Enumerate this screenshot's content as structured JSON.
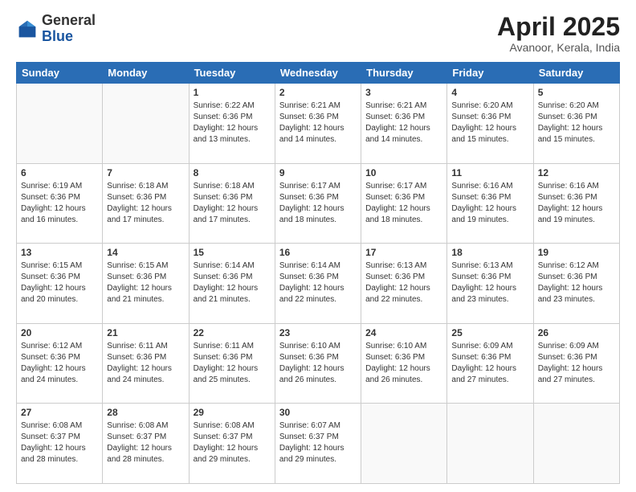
{
  "header": {
    "logo_general": "General",
    "logo_blue": "Blue",
    "title": "April 2025",
    "subtitle": "Avanoor, Kerala, India"
  },
  "calendar": {
    "days_of_week": [
      "Sunday",
      "Monday",
      "Tuesday",
      "Wednesday",
      "Thursday",
      "Friday",
      "Saturday"
    ],
    "weeks": [
      [
        {
          "day": "",
          "sunrise": "",
          "sunset": "",
          "daylight": ""
        },
        {
          "day": "",
          "sunrise": "",
          "sunset": "",
          "daylight": ""
        },
        {
          "day": "1",
          "sunrise": "Sunrise: 6:22 AM",
          "sunset": "Sunset: 6:36 PM",
          "daylight": "Daylight: 12 hours and 13 minutes."
        },
        {
          "day": "2",
          "sunrise": "Sunrise: 6:21 AM",
          "sunset": "Sunset: 6:36 PM",
          "daylight": "Daylight: 12 hours and 14 minutes."
        },
        {
          "day": "3",
          "sunrise": "Sunrise: 6:21 AM",
          "sunset": "Sunset: 6:36 PM",
          "daylight": "Daylight: 12 hours and 14 minutes."
        },
        {
          "day": "4",
          "sunrise": "Sunrise: 6:20 AM",
          "sunset": "Sunset: 6:36 PM",
          "daylight": "Daylight: 12 hours and 15 minutes."
        },
        {
          "day": "5",
          "sunrise": "Sunrise: 6:20 AM",
          "sunset": "Sunset: 6:36 PM",
          "daylight": "Daylight: 12 hours and 15 minutes."
        }
      ],
      [
        {
          "day": "6",
          "sunrise": "Sunrise: 6:19 AM",
          "sunset": "Sunset: 6:36 PM",
          "daylight": "Daylight: 12 hours and 16 minutes."
        },
        {
          "day": "7",
          "sunrise": "Sunrise: 6:18 AM",
          "sunset": "Sunset: 6:36 PM",
          "daylight": "Daylight: 12 hours and 17 minutes."
        },
        {
          "day": "8",
          "sunrise": "Sunrise: 6:18 AM",
          "sunset": "Sunset: 6:36 PM",
          "daylight": "Daylight: 12 hours and 17 minutes."
        },
        {
          "day": "9",
          "sunrise": "Sunrise: 6:17 AM",
          "sunset": "Sunset: 6:36 PM",
          "daylight": "Daylight: 12 hours and 18 minutes."
        },
        {
          "day": "10",
          "sunrise": "Sunrise: 6:17 AM",
          "sunset": "Sunset: 6:36 PM",
          "daylight": "Daylight: 12 hours and 18 minutes."
        },
        {
          "day": "11",
          "sunrise": "Sunrise: 6:16 AM",
          "sunset": "Sunset: 6:36 PM",
          "daylight": "Daylight: 12 hours and 19 minutes."
        },
        {
          "day": "12",
          "sunrise": "Sunrise: 6:16 AM",
          "sunset": "Sunset: 6:36 PM",
          "daylight": "Daylight: 12 hours and 19 minutes."
        }
      ],
      [
        {
          "day": "13",
          "sunrise": "Sunrise: 6:15 AM",
          "sunset": "Sunset: 6:36 PM",
          "daylight": "Daylight: 12 hours and 20 minutes."
        },
        {
          "day": "14",
          "sunrise": "Sunrise: 6:15 AM",
          "sunset": "Sunset: 6:36 PM",
          "daylight": "Daylight: 12 hours and 21 minutes."
        },
        {
          "day": "15",
          "sunrise": "Sunrise: 6:14 AM",
          "sunset": "Sunset: 6:36 PM",
          "daylight": "Daylight: 12 hours and 21 minutes."
        },
        {
          "day": "16",
          "sunrise": "Sunrise: 6:14 AM",
          "sunset": "Sunset: 6:36 PM",
          "daylight": "Daylight: 12 hours and 22 minutes."
        },
        {
          "day": "17",
          "sunrise": "Sunrise: 6:13 AM",
          "sunset": "Sunset: 6:36 PM",
          "daylight": "Daylight: 12 hours and 22 minutes."
        },
        {
          "day": "18",
          "sunrise": "Sunrise: 6:13 AM",
          "sunset": "Sunset: 6:36 PM",
          "daylight": "Daylight: 12 hours and 23 minutes."
        },
        {
          "day": "19",
          "sunrise": "Sunrise: 6:12 AM",
          "sunset": "Sunset: 6:36 PM",
          "daylight": "Daylight: 12 hours and 23 minutes."
        }
      ],
      [
        {
          "day": "20",
          "sunrise": "Sunrise: 6:12 AM",
          "sunset": "Sunset: 6:36 PM",
          "daylight": "Daylight: 12 hours and 24 minutes."
        },
        {
          "day": "21",
          "sunrise": "Sunrise: 6:11 AM",
          "sunset": "Sunset: 6:36 PM",
          "daylight": "Daylight: 12 hours and 24 minutes."
        },
        {
          "day": "22",
          "sunrise": "Sunrise: 6:11 AM",
          "sunset": "Sunset: 6:36 PM",
          "daylight": "Daylight: 12 hours and 25 minutes."
        },
        {
          "day": "23",
          "sunrise": "Sunrise: 6:10 AM",
          "sunset": "Sunset: 6:36 PM",
          "daylight": "Daylight: 12 hours and 26 minutes."
        },
        {
          "day": "24",
          "sunrise": "Sunrise: 6:10 AM",
          "sunset": "Sunset: 6:36 PM",
          "daylight": "Daylight: 12 hours and 26 minutes."
        },
        {
          "day": "25",
          "sunrise": "Sunrise: 6:09 AM",
          "sunset": "Sunset: 6:36 PM",
          "daylight": "Daylight: 12 hours and 27 minutes."
        },
        {
          "day": "26",
          "sunrise": "Sunrise: 6:09 AM",
          "sunset": "Sunset: 6:36 PM",
          "daylight": "Daylight: 12 hours and 27 minutes."
        }
      ],
      [
        {
          "day": "27",
          "sunrise": "Sunrise: 6:08 AM",
          "sunset": "Sunset: 6:37 PM",
          "daylight": "Daylight: 12 hours and 28 minutes."
        },
        {
          "day": "28",
          "sunrise": "Sunrise: 6:08 AM",
          "sunset": "Sunset: 6:37 PM",
          "daylight": "Daylight: 12 hours and 28 minutes."
        },
        {
          "day": "29",
          "sunrise": "Sunrise: 6:08 AM",
          "sunset": "Sunset: 6:37 PM",
          "daylight": "Daylight: 12 hours and 29 minutes."
        },
        {
          "day": "30",
          "sunrise": "Sunrise: 6:07 AM",
          "sunset": "Sunset: 6:37 PM",
          "daylight": "Daylight: 12 hours and 29 minutes."
        },
        {
          "day": "",
          "sunrise": "",
          "sunset": "",
          "daylight": ""
        },
        {
          "day": "",
          "sunrise": "",
          "sunset": "",
          "daylight": ""
        },
        {
          "day": "",
          "sunrise": "",
          "sunset": "",
          "daylight": ""
        }
      ]
    ]
  }
}
